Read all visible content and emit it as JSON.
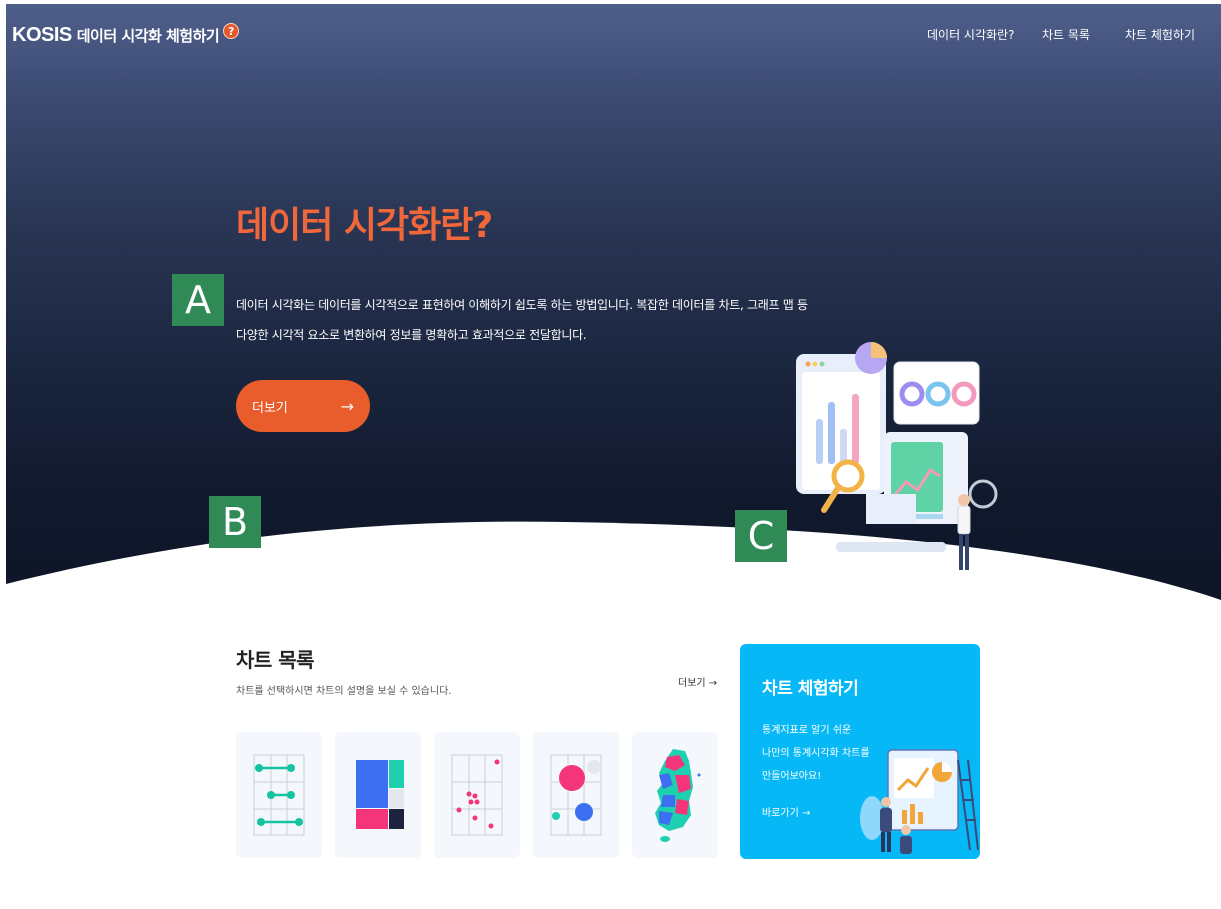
{
  "header": {
    "logo_brand": "KOSIS",
    "logo_title": "데이터 시각화 체험하기",
    "help_symbol": "?",
    "nav": [
      {
        "label": "데이터 시각화란?"
      },
      {
        "label": "차트 목록"
      },
      {
        "label": "차트 체험하기"
      }
    ]
  },
  "hero": {
    "title": "데이터 시각화란?",
    "description_lines": [
      "데이터 시각화는 데이터를 시각적으로 표현하여 이해하기 쉽도록 하는 방법입니다. 복잡한 데이터를 차트, 그래프 맵 등",
      "다양한 시각적 요소로 변환하여 정보를 명확하고 효과적으로 전달합니다."
    ],
    "more_button": "더보기",
    "arrow": "→"
  },
  "markers": {
    "a": "A",
    "b": "B",
    "c": "C"
  },
  "chart_list": {
    "title": "차트 목록",
    "subtitle": "차트를 선택하시면 차트의 설명을 보실 수 있습니다.",
    "more": "더보기 →",
    "cards": [
      {
        "icon": "dumbbell-chart-icon"
      },
      {
        "icon": "treemap-chart-icon"
      },
      {
        "icon": "scatter-chart-icon"
      },
      {
        "icon": "bubble-chart-icon"
      },
      {
        "icon": "korea-map-chart-icon"
      }
    ]
  },
  "promo": {
    "title": "차트 체험하기",
    "lines": [
      "통계지표로 알기 쉬운",
      "나만의 통계시각화 차트를",
      "만들어보아요!"
    ],
    "link": "바로가기 →"
  },
  "colors": {
    "accent_orange": "#e95c2c",
    "title_orange": "#f0673b",
    "promo_blue": "#07b8f7",
    "marker_green": "#2f8a55"
  }
}
